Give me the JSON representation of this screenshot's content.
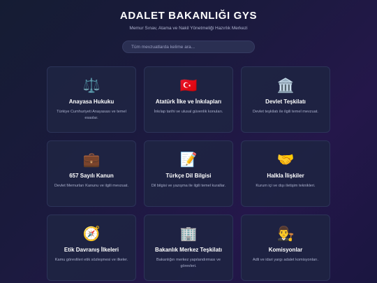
{
  "header": {
    "title": "ADALET BAKANLIĞI GYS",
    "subtitle": "Memur Sınav, Atama ve Nakil Yönetmeliği Hazırlık Merkezi"
  },
  "search": {
    "placeholder": "Tüm mevzuatlarda kelime ara..."
  },
  "cards": [
    {
      "icon": "⚖️",
      "icon_name": "scales-icon",
      "title": "Anayasa Hukuku",
      "desc": "Türkiye Cumhuriyeti Anayasası ve temel esaslar."
    },
    {
      "icon": "🇹🇷",
      "icon_name": "turkey-flag-icon",
      "title": "Atatürk İlke ve İnkılapları",
      "desc": "İnkılap tarihi ve ulusal güvenlik konuları."
    },
    {
      "icon": "🏛️",
      "icon_name": "government-building-icon",
      "title": "Devlet Teşkilatı",
      "desc": "Devlet teşkilatı ile ilgili temel mevzuat."
    },
    {
      "icon": "💼",
      "icon_name": "briefcase-icon",
      "title": "657 Sayılı Kanun",
      "desc": "Devlet Memurları Kanunu ve ilgili mevzuat."
    },
    {
      "icon": "📝",
      "icon_name": "memo-icon",
      "title": "Türkçe Dil Bilgisi",
      "desc": "Dil bilgisi ve yazışma ile ilgili temel kurallar."
    },
    {
      "icon": "🤝",
      "icon_name": "handshake-icon",
      "title": "Halkla İlişkiler",
      "desc": "Kurum içi ve dışı iletişim teknikleri."
    },
    {
      "icon": "🧭",
      "icon_name": "compass-icon",
      "title": "Etik Davranış İlkeleri",
      "desc": "Kamu görevlileri etik sözleşmesi ve ilkeler."
    },
    {
      "icon": "🏢",
      "icon_name": "office-building-icon",
      "title": "Bakanlık Merkez Teşkilatı",
      "desc": "Bakanlığın merkez yapılandırması ve görevleri."
    },
    {
      "icon": "👨‍⚖️",
      "icon_name": "judge-icon",
      "title": "Komisyonlar",
      "desc": "Adli ve idari yargı adalet komisyonları."
    }
  ]
}
